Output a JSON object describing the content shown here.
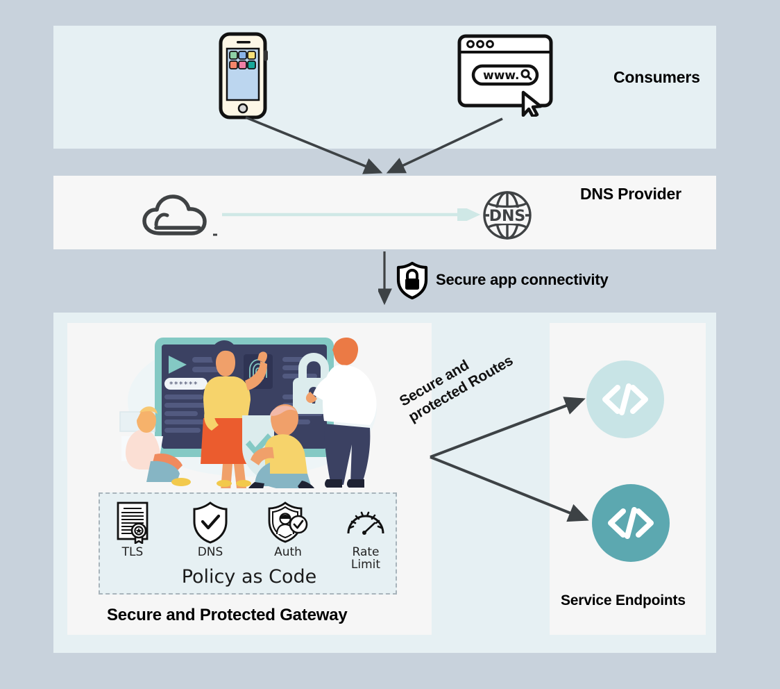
{
  "page": {
    "background_color": "#c8d2dc",
    "title": "API gateway secure connectivity architecture"
  },
  "bands": {
    "consumers": {
      "label": "Consumers",
      "background_color": "#e6f0f3",
      "icons": [
        {
          "name": "mobile-phone-icon",
          "alt": "Smartphone with app grid"
        },
        {
          "name": "browser-window-icon",
          "alt": "Browser window with www address bar and cursor"
        }
      ],
      "browser": {
        "address_text": "www.",
        "dots": 3
      }
    },
    "dns": {
      "label": "DNS Provider",
      "background_color": "#f7f7f7",
      "globe_text": "DNS",
      "arrow_color": "#cfe8e6",
      "icons": [
        {
          "name": "cloud-icon",
          "alt": "Outlined cloud"
        },
        {
          "name": "globe-dns-icon",
          "alt": "Globe with DNS text"
        }
      ]
    },
    "connector": {
      "label": "Secure app connectivity",
      "icon": "shield-lock-icon"
    },
    "gateway": {
      "title": "Secure and Protected Gateway",
      "outer_background_color": "#e6f0f3",
      "panel_background_color": "#f6f6f6",
      "illustration": "security-team-illustration",
      "illustration_alt": "People securing a dashboard with padlock, fingerprint and password screen",
      "password_mask": "✱ ✱ ✱ ✱ ✱ ✱",
      "policy": {
        "title": "Policy as Code",
        "border_color": "#a8b4bb",
        "background_color": "#e6f0f3",
        "items": [
          {
            "label": "TLS",
            "icon": "certificate-icon"
          },
          {
            "label": "DNS",
            "icon": "shield-check-icon"
          },
          {
            "label": "Auth",
            "icon": "shield-person-check-icon"
          },
          {
            "label": "Rate\nLimit",
            "label_line1": "Rate",
            "label_line2": "Limit",
            "icon": "gauge-icon"
          }
        ]
      }
    },
    "routes": {
      "label_line1": "Secure and",
      "label_line2": "protected Routes",
      "arrow_color": "#3d4245"
    },
    "endpoints": {
      "label": "Service Endpoints",
      "panel_background_color": "#f6f6f6",
      "items": [
        {
          "name": "service-endpoint-1",
          "icon": "code-brackets-icon",
          "glyph": "</>",
          "color": "#c8e4e6"
        },
        {
          "name": "service-endpoint-2",
          "icon": "code-brackets-icon",
          "glyph": "</>",
          "color": "#5ca8b0"
        }
      ]
    }
  }
}
